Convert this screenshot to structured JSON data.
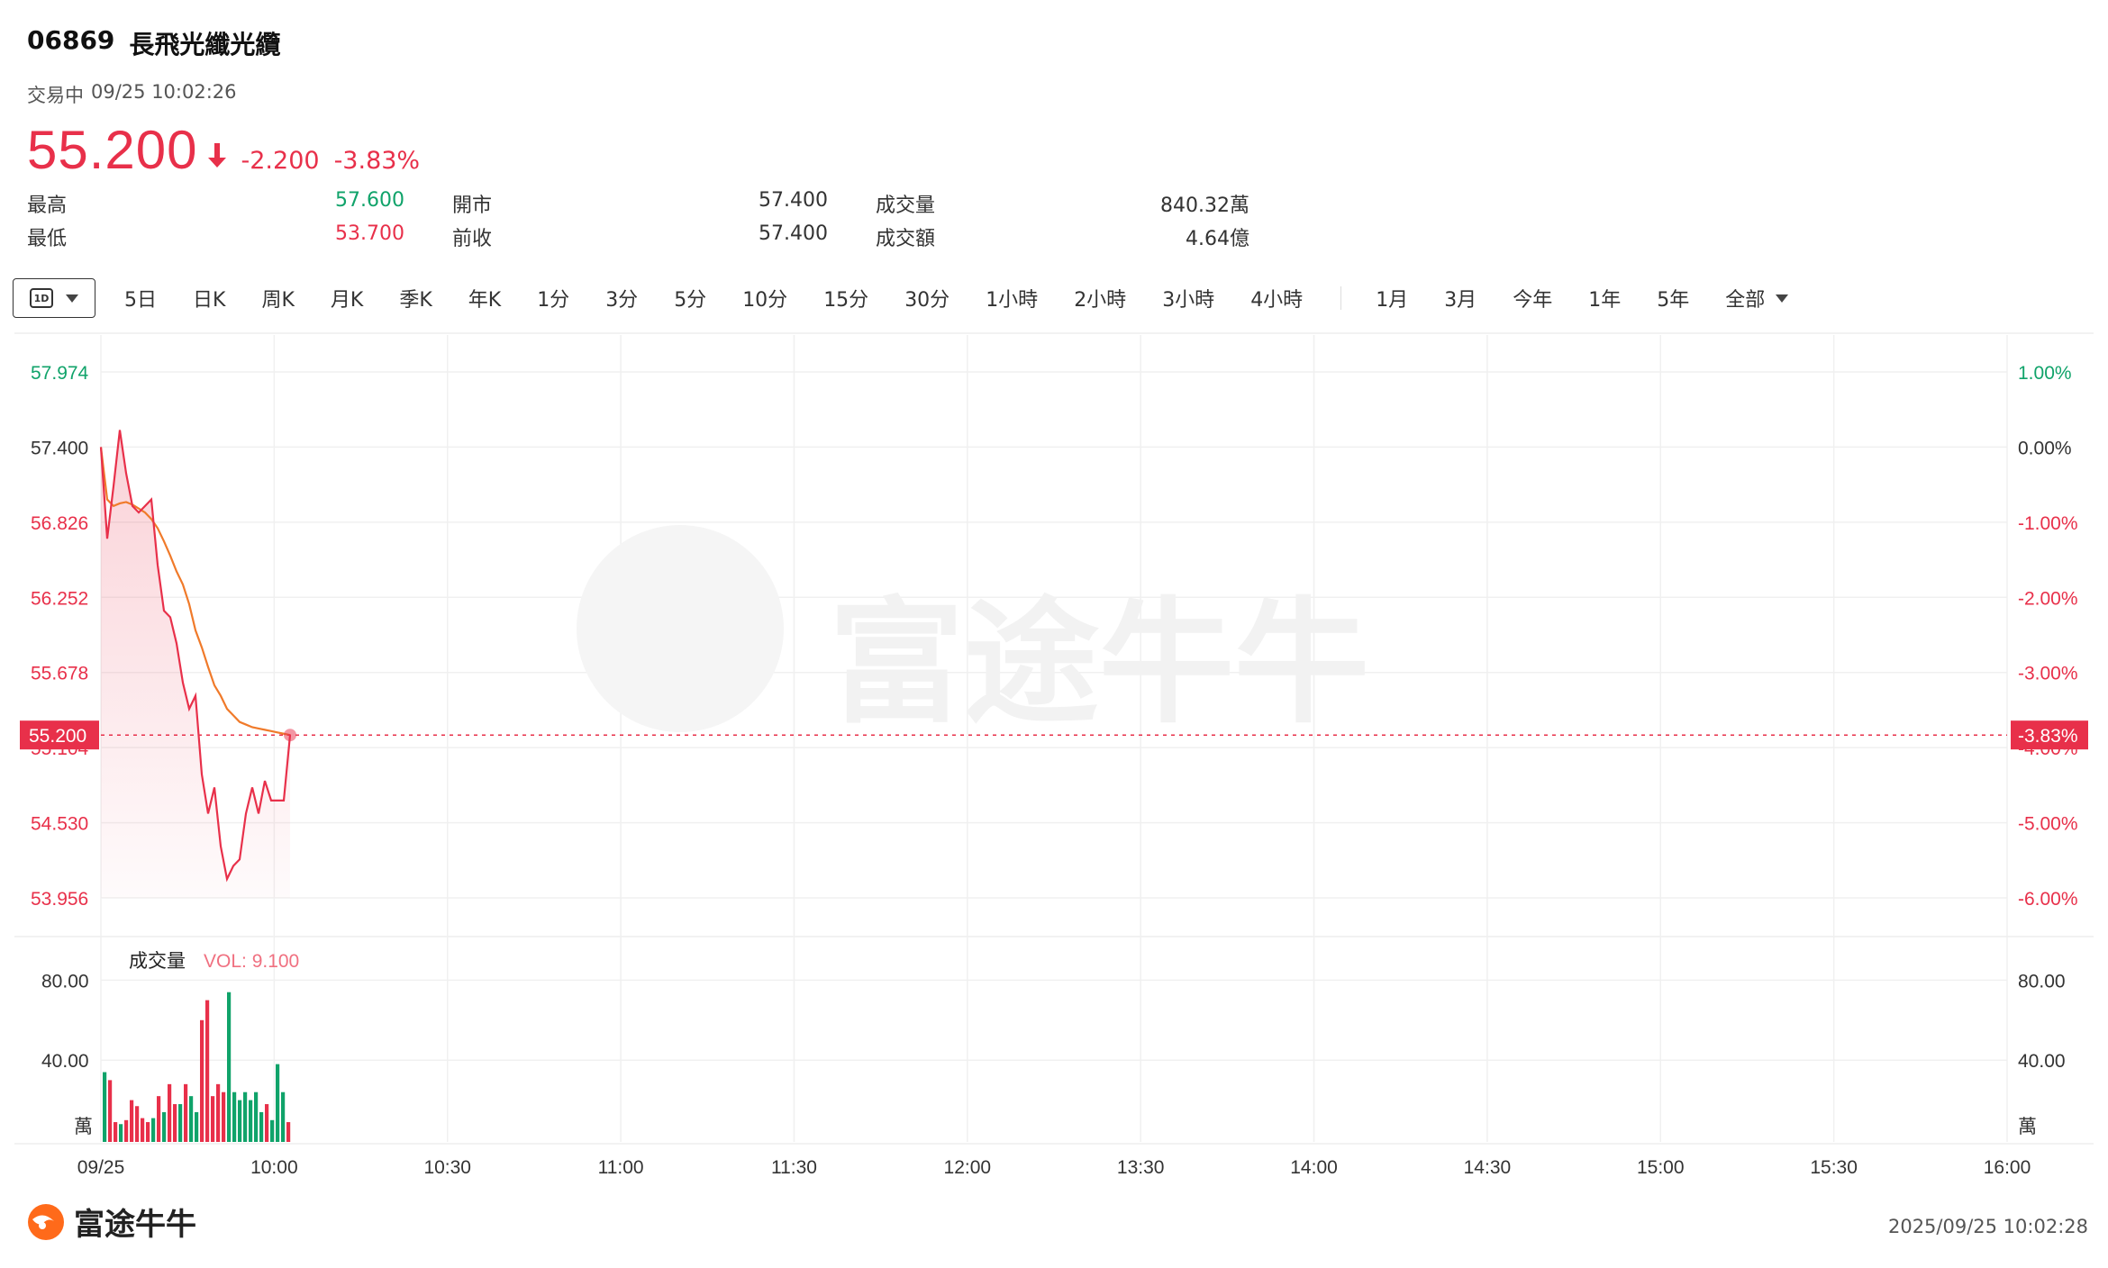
{
  "stock": {
    "code": "06869",
    "name": "長飛光纖光纜",
    "status": "交易中",
    "datetime": "09/25 10:02:26",
    "price": "55.200",
    "change": "-2.200",
    "change_pct": "-3.83%"
  },
  "stats": {
    "high_label": "最高",
    "high_value": "57.600",
    "low_label": "最低",
    "low_value": "53.700",
    "open_label": "開市",
    "open_value": "57.400",
    "prev_label": "前收",
    "prev_value": "57.400",
    "volume_label": "成交量",
    "volume_value": "840.32萬",
    "turnover_label": "成交額",
    "turnover_value": "4.64億"
  },
  "periods": {
    "selected_icon": "1D",
    "group1": [
      "5日",
      "日K",
      "周K",
      "月K",
      "季K",
      "年K",
      "1分",
      "3分",
      "5分",
      "10分",
      "15分",
      "30分",
      "1小時",
      "2小時",
      "3小時",
      "4小時"
    ],
    "group2": [
      "1月",
      "3月",
      "今年",
      "1年",
      "5年",
      "全部"
    ]
  },
  "chart_data": {
    "type": "line",
    "price_ticks_left": [
      "57.974",
      "57.400",
      "56.826",
      "56.252",
      "55.678",
      "55.104",
      "54.530",
      "53.956"
    ],
    "pct_ticks_right": [
      "1.00%",
      "0.00%",
      "-1.00%",
      "-2.00%",
      "-3.00%",
      "-4.00%",
      "-5.00%",
      "-6.00%"
    ],
    "current_price_tag": "55.200",
    "current_pct_tag": "-3.83%",
    "ylim": [
      53.956,
      57.974
    ],
    "x_ticks": [
      "09/25",
      "10:00",
      "10:30",
      "11:00",
      "11:30",
      "12:00",
      "13:30",
      "14:00",
      "14:30",
      "15:00",
      "15:30",
      "16:00"
    ],
    "series": [
      {
        "values": [
          57.4,
          56.7,
          57.1,
          57.53,
          57.2,
          56.95,
          56.9,
          56.95,
          57.0,
          56.5,
          56.15,
          56.1,
          55.9,
          55.6,
          55.4,
          55.5,
          54.9,
          54.6,
          54.8,
          54.35,
          54.1,
          54.2,
          54.25,
          54.6,
          54.8,
          54.6,
          54.85,
          54.7,
          54.7,
          54.7,
          55.2
        ],
        "color": "#e8304a"
      },
      {
        "values": [
          57.4,
          57.0,
          56.95,
          56.97,
          56.98,
          56.96,
          56.93,
          56.9,
          56.85,
          56.78,
          56.68,
          56.57,
          56.45,
          56.35,
          56.2,
          56.0,
          55.87,
          55.72,
          55.58,
          55.5,
          55.4,
          55.35,
          55.3,
          55.28,
          55.26,
          55.25,
          55.24,
          55.23,
          55.22,
          55.21,
          55.2
        ],
        "color": "#f07a2a"
      }
    ],
    "volume": {
      "label": "成交量",
      "vol_text": "VOL: 9.100",
      "ticks": [
        "80.00",
        "40.00"
      ],
      "unit": "萬",
      "ylim": [
        0,
        100
      ],
      "bars": [
        {
          "v": 34,
          "c": "up"
        },
        {
          "v": 30,
          "c": "down"
        },
        {
          "v": 9,
          "c": "down"
        },
        {
          "v": 8,
          "c": "up"
        },
        {
          "v": 10,
          "c": "down"
        },
        {
          "v": 20,
          "c": "down"
        },
        {
          "v": 17,
          "c": "down"
        },
        {
          "v": 11,
          "c": "down"
        },
        {
          "v": 9,
          "c": "down"
        },
        {
          "v": 11,
          "c": "up"
        },
        {
          "v": 22,
          "c": "down"
        },
        {
          "v": 14,
          "c": "up"
        },
        {
          "v": 28,
          "c": "down"
        },
        {
          "v": 18,
          "c": "down"
        },
        {
          "v": 18,
          "c": "up"
        },
        {
          "v": 28,
          "c": "down"
        },
        {
          "v": 22,
          "c": "up"
        },
        {
          "v": 14,
          "c": "up"
        },
        {
          "v": 60,
          "c": "down"
        },
        {
          "v": 70,
          "c": "down"
        },
        {
          "v": 22,
          "c": "down"
        },
        {
          "v": 28,
          "c": "down"
        },
        {
          "v": 24,
          "c": "down"
        },
        {
          "v": 74,
          "c": "up"
        },
        {
          "v": 24,
          "c": "up"
        },
        {
          "v": 20,
          "c": "up"
        },
        {
          "v": 24,
          "c": "up"
        },
        {
          "v": 20,
          "c": "up"
        },
        {
          "v": 24,
          "c": "up"
        },
        {
          "v": 14,
          "c": "up"
        },
        {
          "v": 18,
          "c": "down"
        },
        {
          "v": 10,
          "c": "up"
        },
        {
          "v": 38,
          "c": "up"
        },
        {
          "v": 24,
          "c": "up"
        },
        {
          "v": 9,
          "c": "down"
        }
      ]
    },
    "colors": {
      "up": "#10a36a",
      "down": "#e8304a",
      "price": "#e8304a",
      "avg": "#f07a2a"
    }
  },
  "watermark": "富途牛牛",
  "footer": {
    "brand": "富途牛牛",
    "timestamp": "2025/09/25 10:02:28"
  }
}
